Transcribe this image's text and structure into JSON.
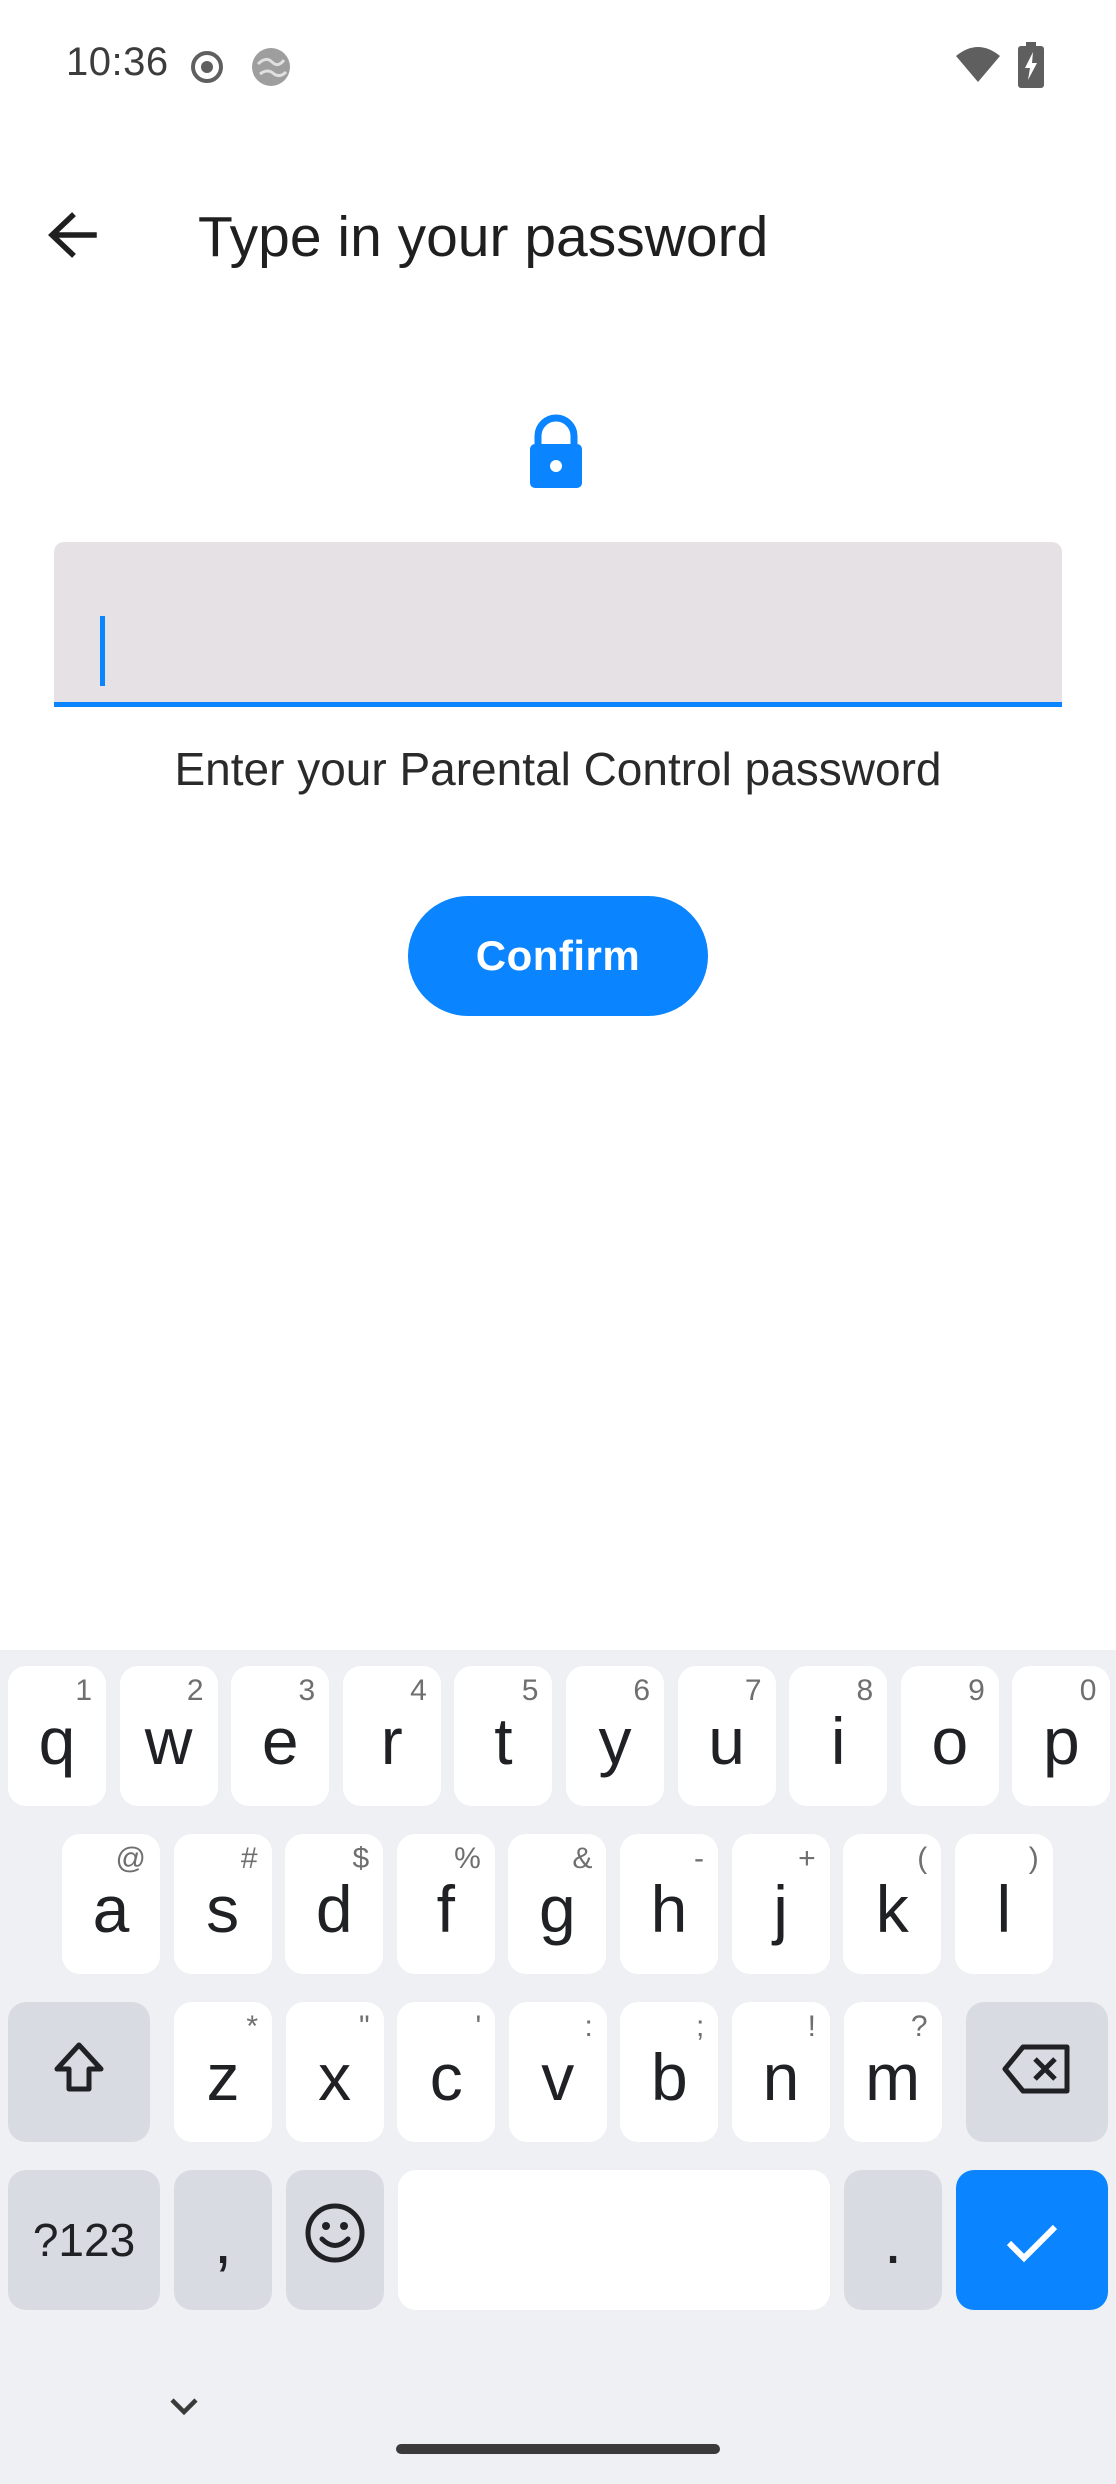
{
  "status_bar": {
    "time": "10:36",
    "icons": [
      "record-icon",
      "globe-icon",
      "wifi-icon",
      "battery-charging-icon"
    ]
  },
  "app_bar": {
    "back_icon": "arrow-back-icon",
    "title": "Type in your password"
  },
  "content": {
    "lock_icon": "lock-icon",
    "password_value": "",
    "helper_text": "Enter your Parental Control password",
    "confirm_label": "Confirm"
  },
  "colors": {
    "accent": "#0a84ff",
    "field_bg": "#e6e1e5",
    "keyboard_bg": "#eff0f3"
  },
  "keyboard": {
    "row1": [
      {
        "key": "q",
        "hint": "1"
      },
      {
        "key": "w",
        "hint": "2"
      },
      {
        "key": "e",
        "hint": "3"
      },
      {
        "key": "r",
        "hint": "4"
      },
      {
        "key": "t",
        "hint": "5"
      },
      {
        "key": "y",
        "hint": "6"
      },
      {
        "key": "u",
        "hint": "7"
      },
      {
        "key": "i",
        "hint": "8"
      },
      {
        "key": "o",
        "hint": "9"
      },
      {
        "key": "p",
        "hint": "0"
      }
    ],
    "row2": [
      {
        "key": "a",
        "hint": "@"
      },
      {
        "key": "s",
        "hint": "#"
      },
      {
        "key": "d",
        "hint": "$"
      },
      {
        "key": "f",
        "hint": "%"
      },
      {
        "key": "g",
        "hint": "&"
      },
      {
        "key": "h",
        "hint": "-"
      },
      {
        "key": "j",
        "hint": "+"
      },
      {
        "key": "k",
        "hint": "("
      },
      {
        "key": "l",
        "hint": ")"
      }
    ],
    "row3": [
      {
        "key": "z",
        "hint": "*"
      },
      {
        "key": "x",
        "hint": "\""
      },
      {
        "key": "c",
        "hint": "'"
      },
      {
        "key": "v",
        "hint": ":"
      },
      {
        "key": "b",
        "hint": ";"
      },
      {
        "key": "n",
        "hint": "!"
      },
      {
        "key": "m",
        "hint": "?"
      }
    ],
    "symbols_label": "?123",
    "comma": ",",
    "period": ".",
    "shift_icon": "shift-icon",
    "backspace_icon": "backspace-icon",
    "emoji_icon": "emoji-icon",
    "enter_icon": "check-icon",
    "hide_icon": "chevron-down-icon"
  }
}
